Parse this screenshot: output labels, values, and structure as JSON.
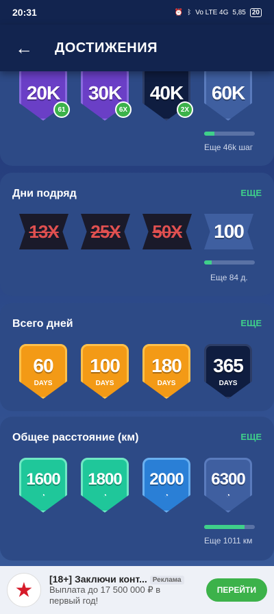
{
  "status": {
    "time": "20:31",
    "network": "Vo LTE 4G",
    "speed": "5,85",
    "battery": "20"
  },
  "header": {
    "back_icon": "arrow-left-icon",
    "title": "ДОСТИЖЕНИЯ"
  },
  "steps": {
    "badges": [
      {
        "label": "20K",
        "mult": "61"
      },
      {
        "label": "30K",
        "mult": "6X"
      },
      {
        "label": "40K",
        "mult": "2X"
      },
      {
        "label": "60K",
        "mult": ""
      }
    ],
    "progress": 0.2,
    "progress_text": "Еще 46k шаг"
  },
  "streak": {
    "title": "Дни подряд",
    "more": "ЕЩЕ",
    "badges": [
      {
        "label": "13X"
      },
      {
        "label": "25X"
      },
      {
        "label": "50X"
      },
      {
        "label": "100"
      }
    ],
    "progress": 0.15,
    "progress_text": "Еще 84 д."
  },
  "total_days": {
    "title": "Всего дней",
    "more": "ЕЩЕ",
    "badges": [
      {
        "label": "60",
        "sub": "DAYS"
      },
      {
        "label": "100",
        "sub": "DAYS"
      },
      {
        "label": "180",
        "sub": "DAYS"
      },
      {
        "label": "365",
        "sub": "DAYS"
      }
    ]
  },
  "distance": {
    "title": "Общее расстояние (км)",
    "more": "ЕЩЕ",
    "badges": [
      {
        "label": "1600"
      },
      {
        "label": "1800"
      },
      {
        "label": "2000"
      },
      {
        "label": "6300"
      }
    ],
    "progress": 0.8,
    "progress_text": "Еще 1011 км"
  },
  "ad": {
    "title": "[18+] Заключи конт...",
    "tag": "Реклама",
    "subtitle": "Выплата до 17 500 000 ₽ в первый год!",
    "button": "ПЕРЕЙТИ"
  },
  "colors": {
    "accent": "#3fd08a",
    "purple": "#6a3fc6",
    "orange": "#f39a16",
    "teal": "#1fc79a",
    "blue": "#2a7fd6",
    "navy": "#0f1d40"
  }
}
